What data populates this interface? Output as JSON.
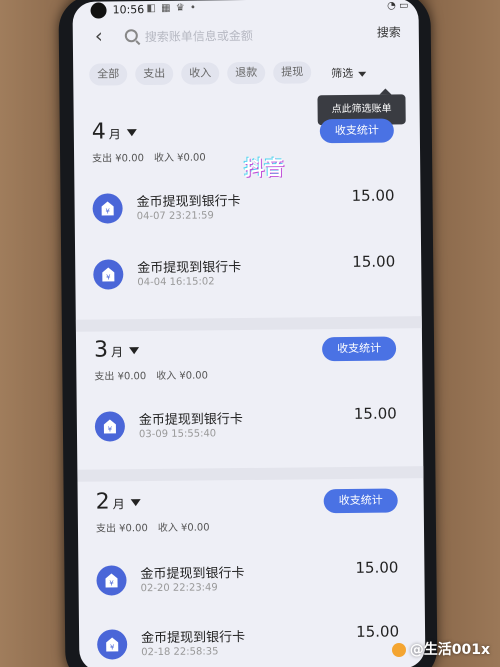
{
  "status_bar": {
    "time": "10:56",
    "icons": "◧ ▦ ♛ •"
  },
  "header": {
    "search_placeholder": "搜索账单信息或金额",
    "search_label": "搜索"
  },
  "filters": {
    "chips": [
      "全部",
      "支出",
      "收入",
      "退款",
      "提现"
    ],
    "dropdown_label": "筛选"
  },
  "tooltip": "点此筛选账单",
  "overlay_text": "抖音",
  "months": [
    {
      "month": "4",
      "unit": "月",
      "expense": "支出 ¥0.00",
      "income": "收入 ¥0.00",
      "stats_label": "收支统计",
      "transactions": [
        {
          "title": "金币提现到银行卡",
          "time": "04-07 23:21:59",
          "amount": "15.00"
        },
        {
          "title": "金币提现到银行卡",
          "time": "04-04 16:15:02",
          "amount": "15.00"
        }
      ]
    },
    {
      "month": "3",
      "unit": "月",
      "expense": "支出 ¥0.00",
      "income": "收入 ¥0.00",
      "stats_label": "收支统计",
      "transactions": [
        {
          "title": "金币提现到银行卡",
          "time": "03-09 15:55:40",
          "amount": "15.00"
        }
      ]
    },
    {
      "month": "2",
      "unit": "月",
      "expense": "支出 ¥0.00",
      "income": "收入 ¥0.00",
      "stats_label": "收支统计",
      "transactions": [
        {
          "title": "金币提现到银行卡",
          "time": "02-20 22:23:49",
          "amount": "15.00"
        },
        {
          "title": "金币提现到银行卡",
          "time": "02-18 22:58:35",
          "amount": "15.00"
        }
      ]
    }
  ],
  "watermark": "@生活001x",
  "colors": {
    "accent": "#4a72e4",
    "icon_bg": "#4a66d8",
    "screen_bg": "#eeeff6"
  }
}
